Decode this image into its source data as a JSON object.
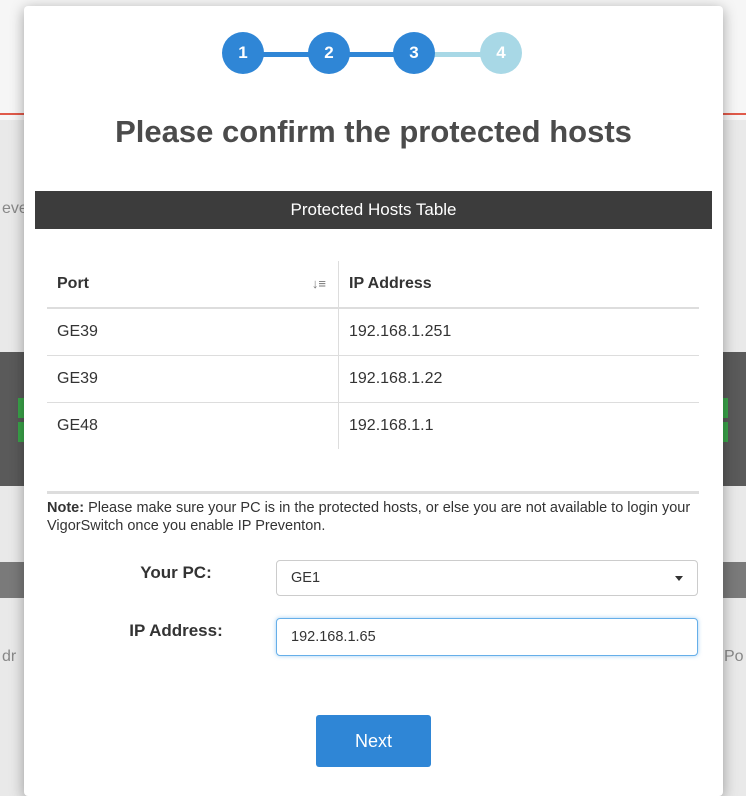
{
  "background": {
    "fragments": [
      "eve",
      "dr",
      "Po"
    ]
  },
  "stepper": {
    "steps": [
      "1",
      "2",
      "3",
      "4"
    ],
    "current": 3,
    "active_color": "#2f86d6",
    "inactive_color": "#a8d8e6"
  },
  "modal": {
    "title": "Please confirm the protected hosts",
    "table_title": "Protected Hosts Table",
    "columns": [
      "Port",
      "IP Address"
    ],
    "rows": [
      {
        "port": "GE39",
        "ip": "192.168.1.251"
      },
      {
        "port": "GE39",
        "ip": "192.168.1.22"
      },
      {
        "port": "GE48",
        "ip": "192.168.1.1"
      }
    ],
    "note_label": "Note:",
    "note_text": " Please make sure your PC is in the protected hosts, or else you are not available to login your VigorSwitch once you enable IP Preventon.",
    "your_pc_label": "Your PC:",
    "your_pc_value": "GE1",
    "ip_label": "IP Address:",
    "ip_value": "192.168.1.65",
    "next_label": "Next"
  }
}
